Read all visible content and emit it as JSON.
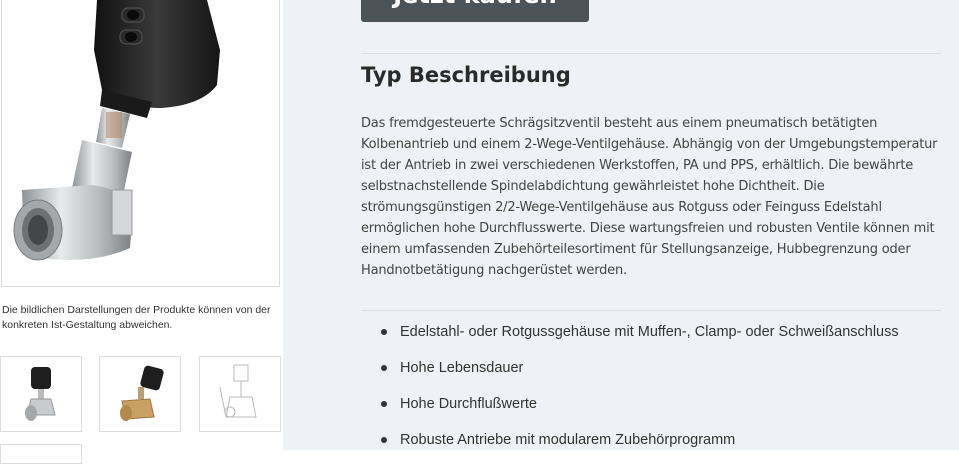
{
  "product": {
    "cart_button_label": "Jetzt kaufen",
    "main_image_alt": "Schrägsitzventil",
    "disclaimer": "Die bildlichen Darstellungen der Produkte können von der konkreten Ist-Gestaltung abweichen.",
    "thumbnails": [
      {
        "name": "Schrägsitzventil Edelstahl"
      },
      {
        "name": "Schrägsitzventil Rotguss"
      },
      {
        "name": "Technische Zeichnung"
      }
    ]
  },
  "type_section": {
    "heading": "Typ Beschreibung",
    "description": "Das fremdgesteuerte Schrägsitzventil besteht aus einem pneumatisch betätigten Kolbenantrieb und einem 2-Wege-Ventilgehäuse. Abhängig von der Umgebungstemperatur ist der Antrieb in zwei verschiedenen Werkstoffen, PA und PPS, erhältlich. Die bewährte selbstnachstellende Spindelabdichtung gewährleistet hohe Dichtheit. Die strömungsgünstigen 2/2-Wege-Ventilgehäuse aus Rotguss oder Feinguss Edelstahl ermöglichen hohe Durchflusswerte. Diese wartungsfreien und robusten Ventile können mit einem umfassenden Zubehörteilesortiment für Stellungsanzeige, Hubbegrenzung oder Handnotbetätigung nachgerüstet werden.",
    "features": [
      "Edelstahl- oder Rotgussgehäuse mit Muffen-, Clamp- oder Schweißanschluss",
      "Hohe Lebensdauer",
      "Hohe Durchflußwerte",
      "Robuste Antriebe mit modularem Zubehörprogramm"
    ]
  },
  "colors": {
    "button_bg": "#4b5358",
    "panel_bg": "#eef1f5",
    "actuator": "#1e1e1e",
    "steel": "#c9ccce",
    "brass": "#c8a064"
  }
}
